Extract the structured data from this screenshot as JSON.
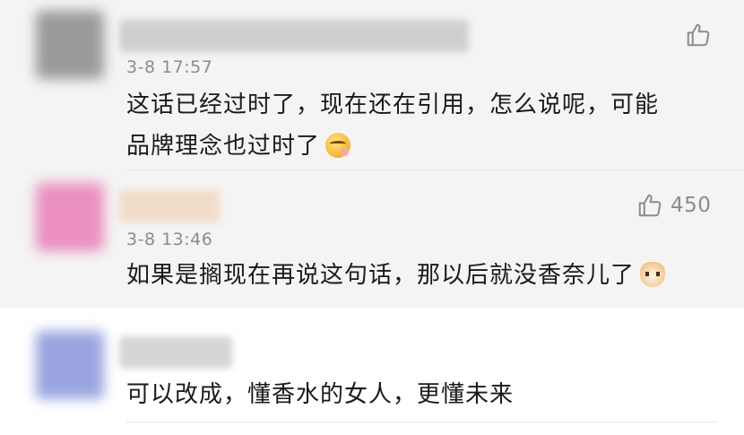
{
  "comments": [
    {
      "time": "3-8 17:57",
      "line1": "这话已经过时了，现在还在引用，怎么说呢，可能",
      "line2": "品牌理念也过时了",
      "emoji": "savoring-face-emoji",
      "likes": "",
      "avatar_color": "#9a9a9a",
      "name_color": "#cfcfcf"
    },
    {
      "time": "3-8 13:46",
      "line1": "如果是搁现在再说这句话，那以后就没香奈儿了",
      "emoji": "cat-face-emoji",
      "likes": "450",
      "avatar_color": "#ea8fbf",
      "name_color": "#f2dcc8"
    },
    {
      "time": "",
      "line1": "可以改成，懂香水的女人，更懂未来",
      "likes": "",
      "avatar_color": "#9aa5df",
      "name_color": "#d6d6d6"
    }
  ],
  "icons": {
    "like": "thumbs-up-icon"
  }
}
